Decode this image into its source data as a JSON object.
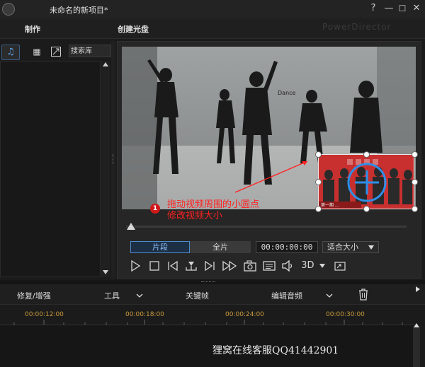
{
  "window": {
    "title": "未命名的新项目*",
    "buttons": [
      "?",
      "—",
      "☐",
      "✕"
    ]
  },
  "header": {
    "produce": "制作",
    "create_disc": "创建光盘",
    "watermark": "PowerDirector"
  },
  "library": {
    "search_placeholder": "搜索库",
    "icons": [
      "music-icon",
      "grid-icon",
      "resize-icon"
    ]
  },
  "preview": {
    "video_logo_text": "Dance",
    "annotation": {
      "number": "1",
      "line1": "拖动视频周围的小圆点",
      "line2": "修改视频大小"
    },
    "pip_banner": "第一期 ...",
    "mode_tabs": [
      "片段",
      "全片"
    ],
    "active_mode": "片段",
    "timecode": "00:00:00:00",
    "fit": "适合大小",
    "three_d": "3D",
    "controls": [
      "play-icon",
      "stop-icon",
      "prev-frame-icon",
      "split-icon",
      "next-frame-icon",
      "fast-forward-icon",
      "snapshot-icon",
      "subtitle-icon",
      "volume-icon",
      "3d-icon",
      "external-view-icon"
    ]
  },
  "tools": {
    "repair": "修复/增强",
    "tools": "工具",
    "keyframe": "关键帧",
    "edit_audio": "编辑音频"
  },
  "timeline": {
    "marks": [
      "00:00:12:00",
      "00:00:18:00",
      "00:00:24:00",
      "00:00:30:00"
    ]
  },
  "watermark_bottom": "狸窝在线客服QQ41442901",
  "colors": {
    "accent": "#4d8ccc",
    "annotation": "#ff2020",
    "ruler_text": "#c89a3c"
  }
}
